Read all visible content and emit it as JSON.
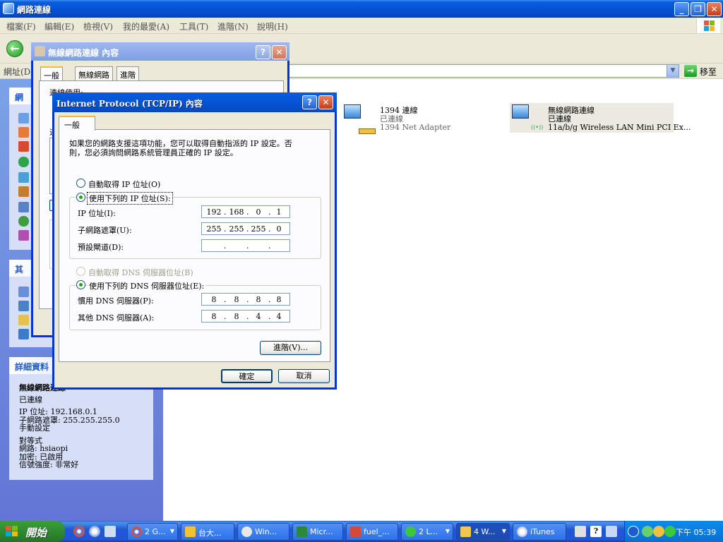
{
  "window": {
    "title": "網路連線"
  },
  "menu": [
    "檔案(F)",
    "編輯(E)",
    "檢視(V)",
    "我的最愛(A)",
    "工具(T)",
    "進階(N)",
    "說明(H)"
  ],
  "address": {
    "label": "網址(D)",
    "go": "移至"
  },
  "left_pane": {
    "panel1_head": "網",
    "panel2_head": "其",
    "details_head": "詳細資料",
    "details": {
      "name": "無線網路連線",
      "status": "已連線",
      "ip": "IP 位址: 192.168.0.1",
      "mask": "子網路遮罩: 255.255.255.0",
      "manual": "手動設定",
      "peer": "對等式",
      "network": "網路: hsiaopi",
      "encryption": "加密: 已啟用",
      "signal": "信號強度: 非常好"
    }
  },
  "connections": [
    {
      "name": "1394 連線",
      "status": "已連線",
      "device": "1394 Net Adapter"
    },
    {
      "name": "無線網路連線",
      "status": "已連線",
      "device": "11a/b/g Wireless LAN Mini PCI Ex..."
    }
  ],
  "dialog1": {
    "title": "無線網路連線 內容",
    "tabs": [
      "一般",
      "無線網路",
      "進階"
    ],
    "connect_using": "連線使用:",
    "partial": "這"
  },
  "dialog2": {
    "title": "Internet Protocol (TCP/IP) 內容",
    "tab": "一般",
    "description_line1": "如果您的網路支援這項功能，您可以取得自動指派的 IP 設定。否",
    "description_line2": "則，您必須詢問網路系統管理員正確的 IP 設定。",
    "auto_ip": "自動取得 IP 位址(O)",
    "manual_ip": "使用下列的 IP 位址(S):",
    "ip_label": "IP 位址(I):",
    "mask_label": "子網路遮罩(U):",
    "gateway_label": "預設閘道(D):",
    "ip": [
      "192",
      "168",
      "0",
      "1"
    ],
    "mask": [
      "255",
      "255",
      "255",
      "0"
    ],
    "gateway": [
      "",
      "",
      "",
      ""
    ],
    "auto_dns": "自動取得 DNS 伺服器位址(B)",
    "manual_dns": "使用下列的 DNS 伺服器位址(E):",
    "dns1_label": "慣用 DNS 伺服器(P):",
    "dns2_label": "其他 DNS 伺服器(A):",
    "dns1": [
      "8",
      "8",
      "8",
      "8"
    ],
    "dns2": [
      "8",
      "8",
      "4",
      "4"
    ],
    "advanced": "進階(V)...",
    "ok": "確定",
    "cancel": "取消"
  },
  "taskbar": {
    "start": "開始",
    "buttons": [
      "2 G...",
      "台大...",
      "Win...",
      "Micr...",
      "fuel_...",
      "2 L...",
      "4 W...",
      "iTunes"
    ],
    "clock": "下午 05:39"
  },
  "colors": {
    "title_blue": "#0554d6",
    "start_green": "#2f8a2f",
    "dialog_face": "#ece9d8"
  }
}
